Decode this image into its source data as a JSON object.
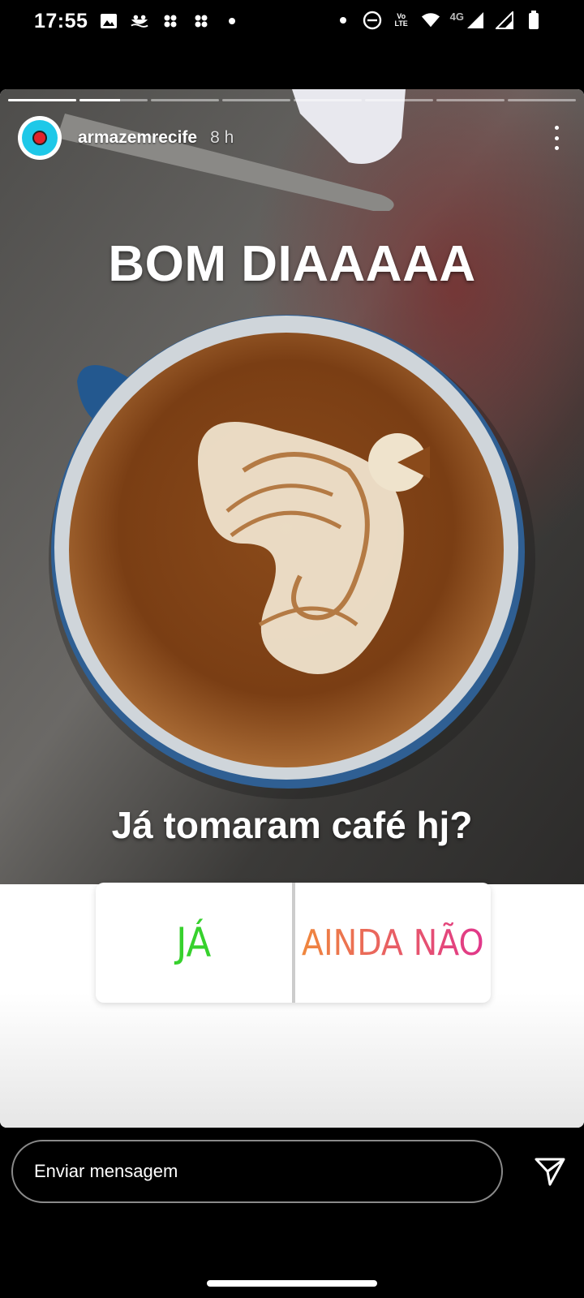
{
  "status_bar": {
    "time": "17:55",
    "left_icons": [
      "image-icon",
      "boat-icon",
      "fan-icon",
      "fan-icon",
      "dot-icon"
    ],
    "right_icons": [
      "dot-icon",
      "do-not-disturb-icon",
      "volte-icon",
      "wifi-icon",
      "signal-icon",
      "signal-icon",
      "battery-icon"
    ],
    "volte_top": "Vo",
    "volte_bottom": "LTE",
    "network": "4G"
  },
  "story": {
    "segments_total": 8,
    "segments_progress": [
      1,
      0.6,
      0,
      0,
      0,
      0,
      0,
      0
    ],
    "username": "armazemrecife",
    "time_ago": "8 h",
    "headline": "BOM DIAAAAA",
    "question": "Já tomaram café hj?",
    "poll": {
      "option_a": "JÁ",
      "option_b": "AINDA NÃO",
      "option_a_color": "#37d12d",
      "option_b_colors": [
        "#f08a3a",
        "#e0338e"
      ]
    }
  },
  "bottom": {
    "message_placeholder": "Enviar mensagem"
  }
}
